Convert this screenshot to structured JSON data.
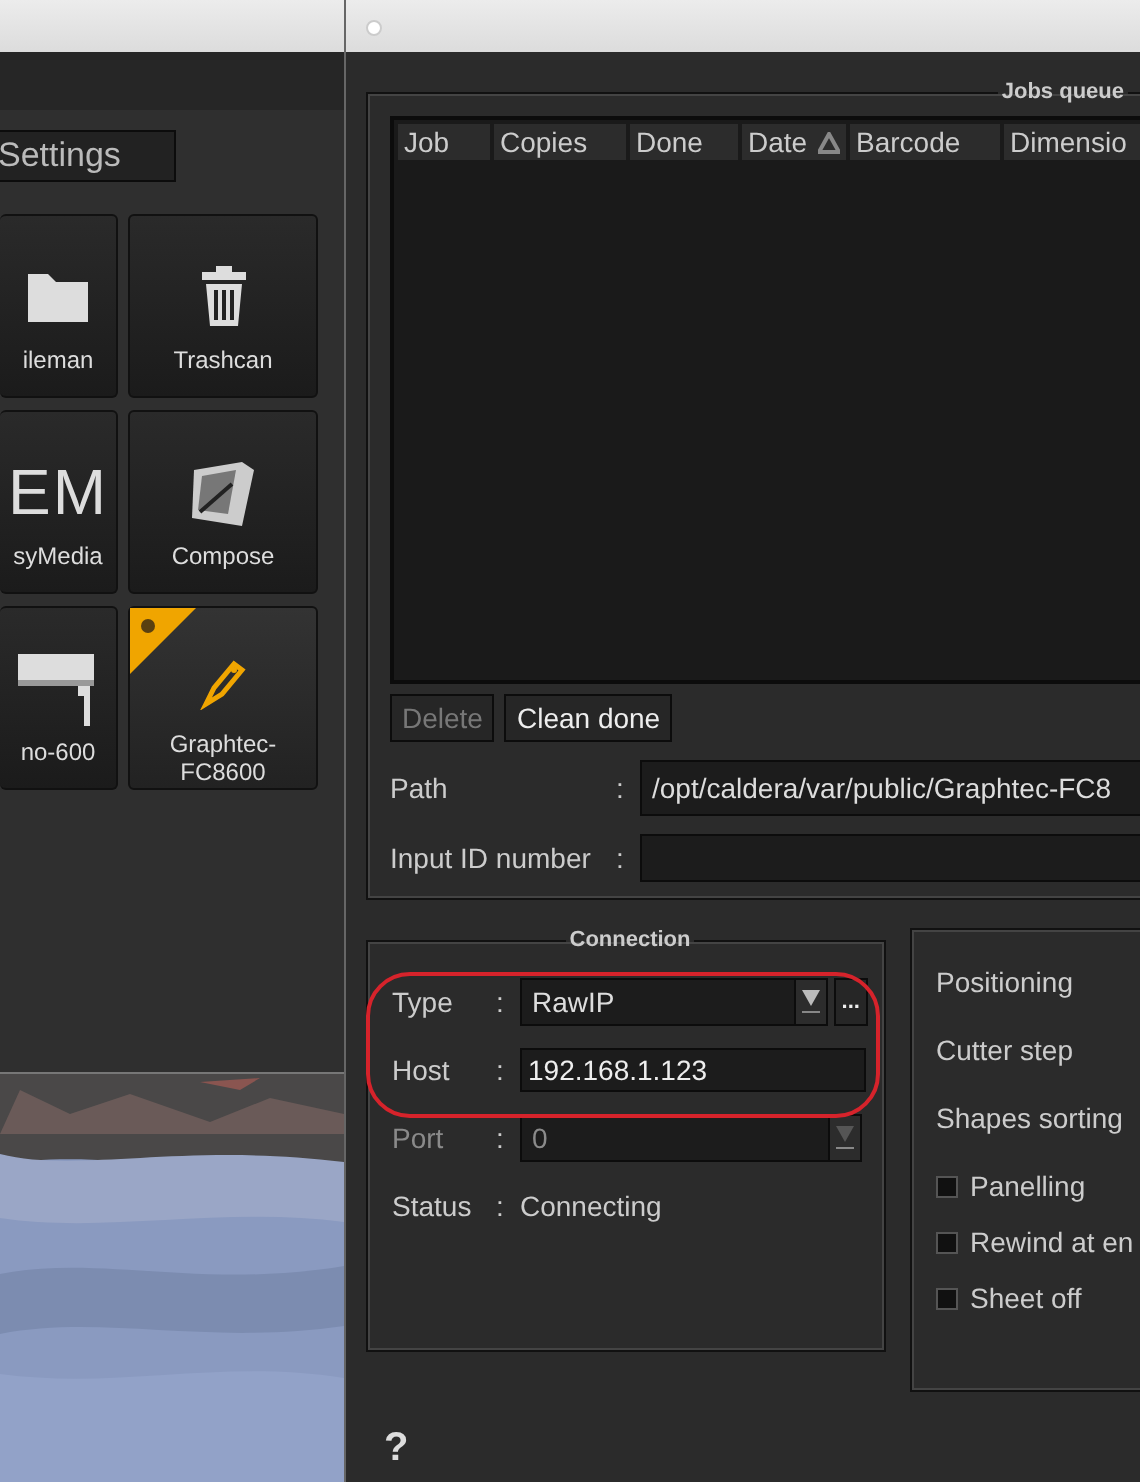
{
  "left_panel": {
    "settings_button": "Settings",
    "tiles": [
      {
        "kind": "folder",
        "label": "ileman",
        "active": false
      },
      {
        "kind": "trash",
        "label": "Trashcan",
        "active": false
      },
      {
        "kind": "logo",
        "logo_text": "EM",
        "label": "syMedia",
        "active": false
      },
      {
        "kind": "compose",
        "label": "Compose",
        "active": false
      },
      {
        "kind": "printer",
        "label": "no-600",
        "active": false
      },
      {
        "kind": "cutter",
        "label": "Graphtec-\nFC8600",
        "active": true
      }
    ]
  },
  "jobs_queue": {
    "title": "Jobs queue",
    "columns": [
      {
        "label": "Job",
        "sorted": false
      },
      {
        "label": "Copies",
        "sorted": false
      },
      {
        "label": "Done",
        "sorted": false
      },
      {
        "label": "Date",
        "sorted": true
      },
      {
        "label": "Barcode",
        "sorted": false
      },
      {
        "label": "Dimensio",
        "sorted": false
      }
    ],
    "buttons": [
      {
        "label": "Delete",
        "disabled": true
      },
      {
        "label": "Clean done",
        "disabled": false
      }
    ],
    "path": {
      "label": "Path",
      "separator": ":",
      "value": "/opt/caldera/var/public/Graphtec-FC8"
    },
    "input_id": {
      "label": "Input ID number",
      "separator": ":"
    }
  },
  "connection": {
    "title": "Connection",
    "rows": [
      {
        "kind": "select",
        "label": "Type",
        "separator": ":",
        "value": "RawIP",
        "disabled": false,
        "more": "..."
      },
      {
        "kind": "input",
        "label": "Host",
        "separator": ":",
        "value": "192.168.1.123",
        "disabled": false
      },
      {
        "kind": "select",
        "label": "Port",
        "separator": ":",
        "value": "0",
        "disabled": true
      },
      {
        "kind": "text",
        "label": "Status",
        "separator": ":",
        "value": "Connecting",
        "disabled": false
      }
    ]
  },
  "options": {
    "labels": [
      "Positioning",
      "Cutter step",
      "Shapes sorting"
    ],
    "checkboxes": [
      {
        "label": "Panelling",
        "checked": false
      },
      {
        "label": "Rewind at en",
        "checked": false
      },
      {
        "label": "Sheet off",
        "checked": false
      }
    ]
  },
  "help": "?"
}
